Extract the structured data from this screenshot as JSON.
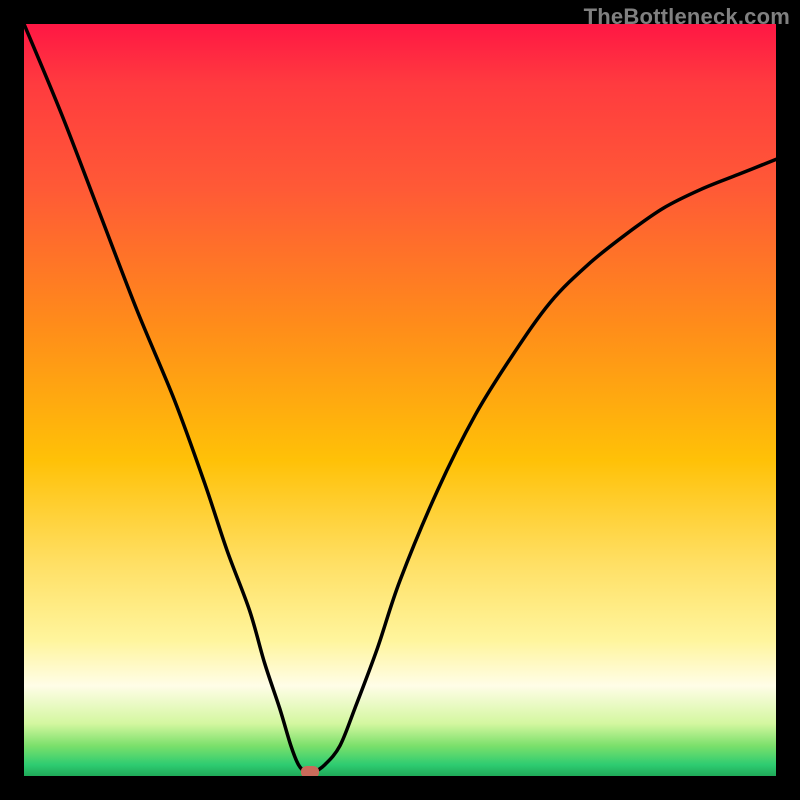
{
  "watermark": {
    "text": "TheBottleneck.com"
  },
  "colors": {
    "frame_bg": "#000000",
    "curve_stroke": "#000000",
    "marker_fill": "#c96a5a",
    "gradient": [
      "#ff1744",
      "#ff3b3f",
      "#ff5a36",
      "#ff8c1a",
      "#ffc107",
      "#ffe066",
      "#fff59d",
      "#fffde7",
      "#d4f7a0",
      "#7be06b",
      "#2ecc71",
      "#1fa958"
    ]
  },
  "chart_data": {
    "type": "line",
    "title": "",
    "xlabel": "",
    "ylabel": "",
    "xlim": [
      0,
      100
    ],
    "ylim": [
      0,
      100
    ],
    "series": [
      {
        "name": "bottleneck-curve",
        "x": [
          0,
          5,
          10,
          15,
          20,
          24,
          27,
          30,
          32,
          34,
          35.5,
          36.5,
          37.5,
          38.5,
          40,
          42,
          44,
          47,
          50,
          55,
          60,
          65,
          70,
          75,
          80,
          85,
          90,
          95,
          100
        ],
        "values": [
          100,
          88,
          75,
          62,
          50,
          39,
          30,
          22,
          15,
          9,
          4,
          1.5,
          0.5,
          0.5,
          1.5,
          4,
          9,
          17,
          26,
          38,
          48,
          56,
          63,
          68,
          72,
          75.5,
          78,
          80,
          82
        ]
      }
    ],
    "marker": {
      "name": "current-point",
      "x": 38,
      "y": 0.5
    },
    "grid": false,
    "legend": false
  }
}
